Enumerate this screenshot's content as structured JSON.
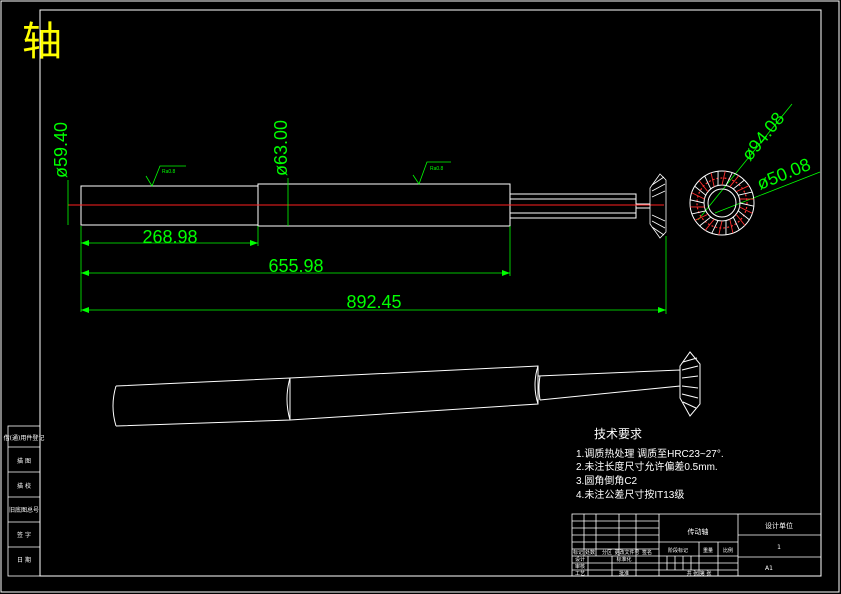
{
  "title": "轴",
  "dimensions": {
    "dia_left": "ø59.40",
    "dia_mid": "ø63.00",
    "dia_outer": "ø94.08",
    "dia_inner": "ø50.08",
    "len_1": "268.98",
    "len_2": "655.98",
    "len_3": "892.45",
    "rough_1": "Ra0.8",
    "rough_2": "Ra0.8"
  },
  "tech_req": {
    "heading": "技术要求",
    "items": [
      "1.调质热处理  调质至HRC23~27°.",
      "2.未注长度尺寸允许偏差0.5mm.",
      "3.圆角倒角C2",
      "4.未注公差尺寸按IT13级"
    ]
  },
  "side_stamp": [
    "借(通)用件登记",
    "描  图",
    "描  校",
    "旧底图总号",
    "签  字",
    "日  期"
  ],
  "title_block": {
    "drawing_name": "传动轴",
    "project": "设计单位",
    "row_labels": [
      "标记",
      "处数",
      "分区",
      "更改文件号",
      "签名",
      "日期"
    ],
    "design": "设计",
    "standard": "标准化",
    "stage_mark": "阶段标记",
    "weight": "重量",
    "scale": "比例",
    "review": "审核",
    "process": "工艺",
    "approve": "批准",
    "sheet": "共  张  第  张",
    "scale_value": "1",
    "code": "A1"
  }
}
